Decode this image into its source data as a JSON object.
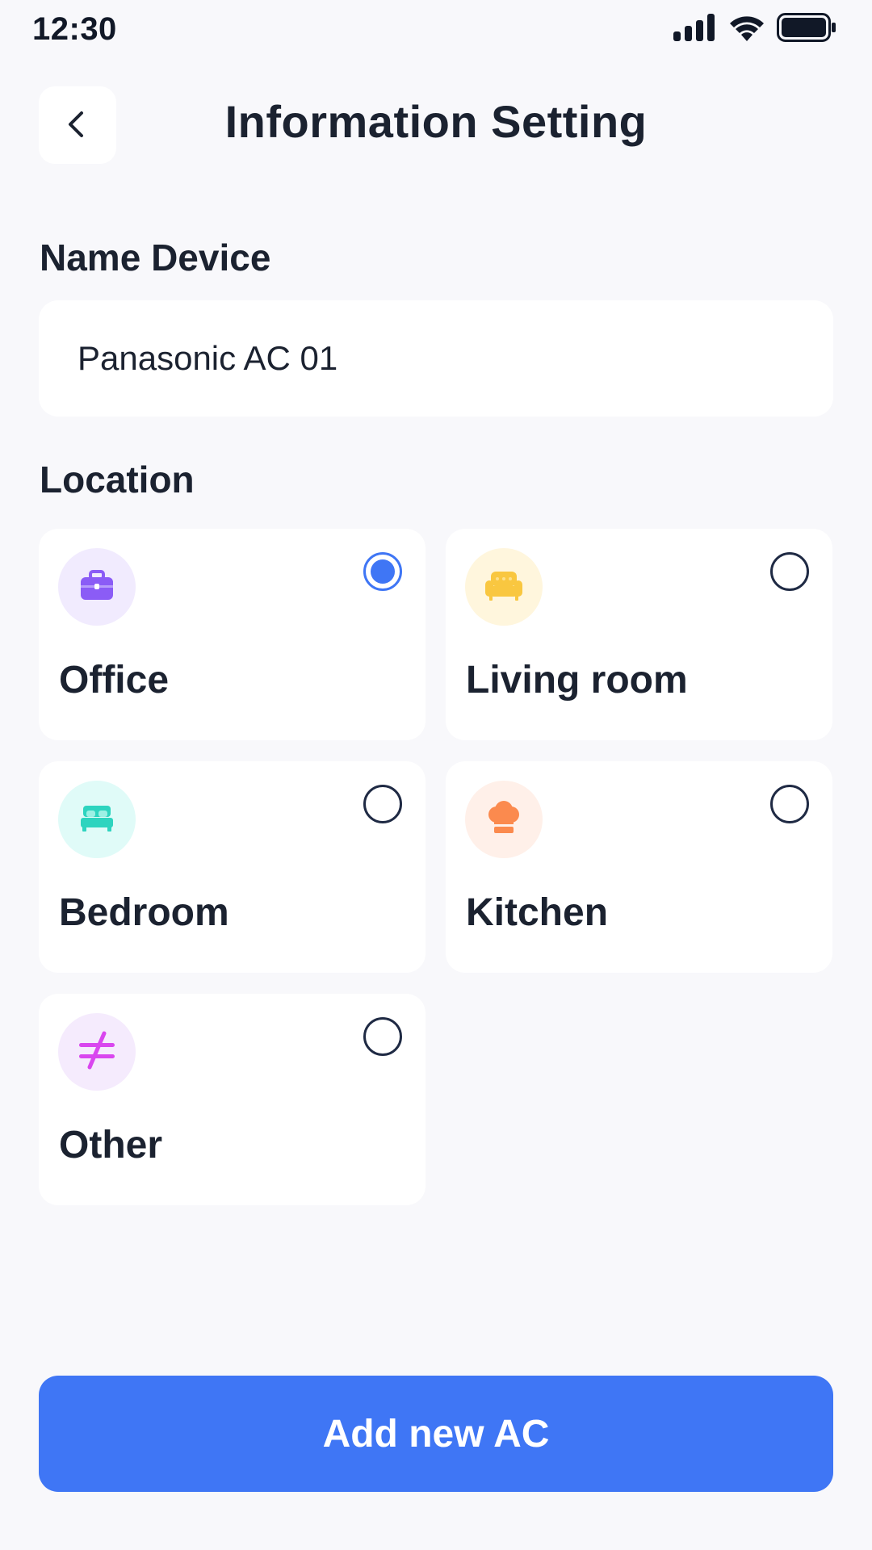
{
  "status_bar": {
    "time": "12:30",
    "icons": [
      "signal-icon",
      "wifi-icon",
      "battery-icon"
    ]
  },
  "header": {
    "back_icon": "chevron-left-icon",
    "title": "Information Setting"
  },
  "name_device": {
    "label": "Name Device",
    "value": "Panasonic AC 01"
  },
  "location": {
    "label": "Location",
    "selected": "Office",
    "options": [
      {
        "label": "Office",
        "icon": "briefcase-icon",
        "icon_color": "#8B5CF6",
        "icon_bg": "#F1EBFE",
        "selected": true
      },
      {
        "label": "Living room",
        "icon": "sofa-icon",
        "icon_color": "#F9C740",
        "icon_bg": "#FFF6DD",
        "selected": false
      },
      {
        "label": "Bedroom",
        "icon": "bed-icon",
        "icon_color": "#2DD4BF",
        "icon_bg": "#E0FBF8",
        "selected": false
      },
      {
        "label": "Kitchen",
        "icon": "chef-hat-icon",
        "icon_color": "#FB8A4E",
        "icon_bg": "#FFF0E9",
        "selected": false
      },
      {
        "label": "Other",
        "icon": "not-equal-icon",
        "icon_color": "#D946EF",
        "icon_bg": "#F5EBFD",
        "selected": false
      }
    ]
  },
  "primary_action": {
    "label": "Add new AC"
  },
  "colors": {
    "accent": "#3F76F5",
    "background": "#F8F8FB",
    "text": "#1B2230"
  }
}
